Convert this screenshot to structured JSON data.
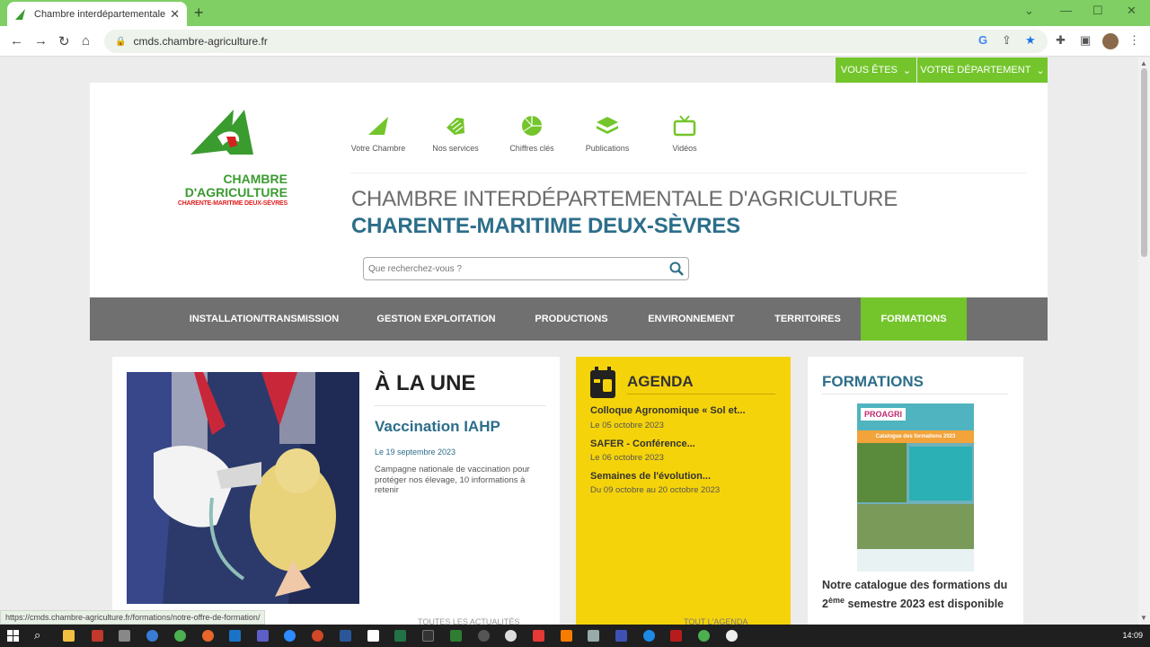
{
  "browser": {
    "tab_title": "Chambre interdépartementale d'agriculture",
    "url": "cmds.chambre-agriculture.fr",
    "status_url": "https://cmds.chambre-agriculture.fr/formations/notre-offre-de-formation/"
  },
  "top_selectors": {
    "vous_etes": "VOUS ÊTES",
    "departement": "VOTRE DÉPARTEMENT"
  },
  "logo": {
    "line1": "CHAMBRE",
    "line2": "D'AGRICULTURE",
    "line3": "CHARENTE-MARITIME DEUX-SÈVRES"
  },
  "quick_links": [
    {
      "label": "Votre Chambre",
      "icon": "leaf-icon"
    },
    {
      "label": "Nos services",
      "icon": "hand-icon"
    },
    {
      "label": "Chiffres clés",
      "icon": "pie-chart-icon"
    },
    {
      "label": "Publications",
      "icon": "stack-icon"
    },
    {
      "label": "Vidéos",
      "icon": "tv-icon"
    }
  ],
  "title": {
    "line1": "CHAMBRE INTERDÉPARTEMENTALE D'AGRICULTURE",
    "line2": "CHARENTE-MARITIME DEUX-SÈVRES"
  },
  "search": {
    "placeholder": "Que recherchez-vous ?"
  },
  "menu": [
    "INSTALLATION/TRANSMISSION",
    "GESTION EXPLOITATION",
    "PRODUCTIONS",
    "ENVIRONNEMENT",
    "TERRITOIRES",
    "FORMATIONS"
  ],
  "une": {
    "heading": "À LA UNE",
    "title": "Vaccination IAHP",
    "date": "Le 19 septembre 2023",
    "text": "Campagne nationale de vaccination pour protéger nos élevage, 10 informations à retenir",
    "more": "TOUTES LES ACTUALITÉS"
  },
  "agenda": {
    "heading": "AGENDA",
    "events": [
      {
        "title": "Colloque Agronomique « Sol et...",
        "date": "Le 05 octobre 2023"
      },
      {
        "title": "SAFER - Conférence...",
        "date": "Le 06 octobre 2023"
      },
      {
        "title": "Semaines de l'évolution...",
        "date": "Du 09 octobre au 20 octobre 2023"
      }
    ],
    "more": "TOUT L'AGENDA"
  },
  "formations": {
    "heading": "FORMATIONS",
    "catalog_brand": "PROAGRI",
    "catalog_title": "Catalogue des formations 2023",
    "text_pre": "Notre catalogue des formations du 2",
    "text_sup": "ème",
    "text_post": " semestre 2023 est disponible"
  },
  "clock": "14:09",
  "colors": {
    "green": "#73c52b",
    "blue": "#2c6e8a",
    "yellow": "#f5d30a",
    "grey_menu": "#707070"
  }
}
